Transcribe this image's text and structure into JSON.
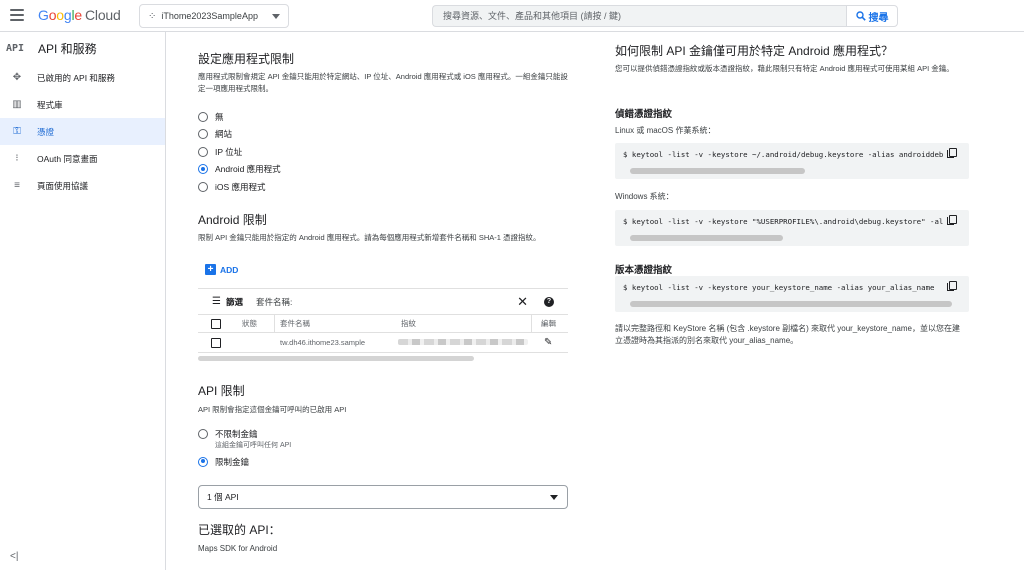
{
  "header": {
    "logo_google": [
      "G",
      "o",
      "o",
      "g",
      "l",
      "e"
    ],
    "logo_cloud": "Cloud",
    "project_name": "iThome2023SampleApp",
    "search_placeholder": "搜尋資源、文件、產品和其他項目 (請按 / 鍵)",
    "search_button": "搜尋"
  },
  "sidebar": {
    "section_mark": "API",
    "section_title": "API 和服務",
    "items": [
      {
        "label": "已啟用的 API 和服務",
        "icon": "diamond-nodes-icon",
        "active": false
      },
      {
        "label": "程式庫",
        "icon": "library-icon",
        "active": false
      },
      {
        "label": "憑證",
        "icon": "key-icon",
        "active": true
      },
      {
        "label": "OAuth 同意畫面",
        "icon": "consent-icon",
        "active": false
      },
      {
        "label": "頁面使用協議",
        "icon": "agreement-icon",
        "active": false
      }
    ],
    "collapse_glyph": "<|"
  },
  "app_restrictions": {
    "title": "設定應用程式限制",
    "description": "應用程式限制會規定 API 金鑰只能用於特定網站、IP 位址、Android 應用程式或 iOS 應用程式。一組金鑰只能設定一項應用程式限制。",
    "options": [
      {
        "label": "無",
        "checked": false
      },
      {
        "label": "網站",
        "checked": false
      },
      {
        "label": "IP 位址",
        "checked": false
      },
      {
        "label": "Android 應用程式",
        "checked": true
      },
      {
        "label": "iOS 應用程式",
        "checked": false
      }
    ]
  },
  "android_restrictions": {
    "title": "Android 限制",
    "description": "限制 API 金鑰只能用於指定的 Android 應用程式。請為每個應用程式新增套件名稱和 SHA-1 憑證指紋。",
    "add_label": "ADD",
    "filter_label": "篩選",
    "filter_field": "套件名稱:",
    "columns": [
      "狀態",
      "套件名稱",
      "指紋",
      "編輯"
    ],
    "rows": [
      {
        "status": "",
        "package": "tw.dh46.ithome23.sample",
        "fingerprint": ""
      }
    ]
  },
  "api_restrictions": {
    "title": "API 限制",
    "description": "API 限制會指定這個金鑰可呼叫的已啟用 API",
    "options": [
      {
        "label": "不限制金鑰",
        "sub": "這組金鑰可呼叫任何 API",
        "checked": false
      },
      {
        "label": "限制金鑰",
        "sub": "",
        "checked": true
      }
    ],
    "select_value": "1 個 API",
    "selected_title": "已選取的 API：",
    "selected_items": [
      "Maps SDK for Android"
    ]
  },
  "help": {
    "title": "如何限制 API 金鑰僅可用於特定 Android 應用程式？",
    "description": "您可以提供偵錯憑證指紋或版本憑證指紋，藉此限制只有特定 Android 應用程式可使用某組 API 金鑰。",
    "debug_title": "偵錯憑證指紋",
    "linux_label": "Linux 或 macOS 作業系統：",
    "linux_cmd": "$  keytool -list -v -keystore ~/.android/debug.keystore -alias androiddebugkey -storepass android -keypass android",
    "windows_label": "Windows 系統：",
    "windows_cmd": "$  keytool -list -v -keystore \"%USERPROFILE%\\.android\\debug.keystore\" -alias androiddebugkey -storepass android -keypass android",
    "release_title": "版本憑證指紋",
    "release_cmd": "$  keytool -list -v -keystore your_keystore_name -alias your_alias_name",
    "release_note": "請以完整路徑和 KeyStore 名稱 (包含 .keystore 副檔名) 來取代 your_keystore_name，並以您在建立憑證時為其指派的別名來取代 your_alias_name。"
  }
}
